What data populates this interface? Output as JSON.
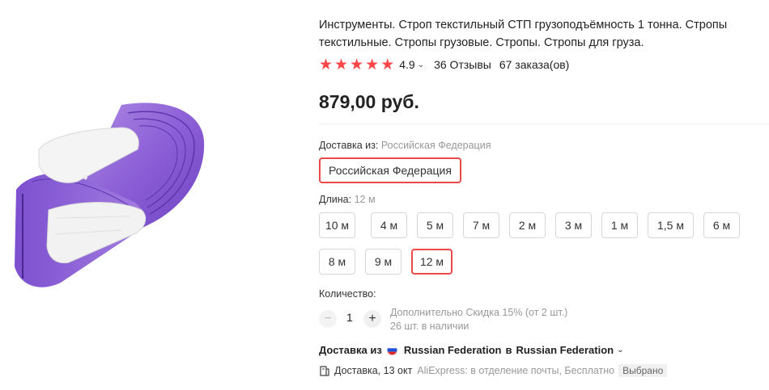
{
  "product": {
    "title": "Инструменты. Строп текстильный СТП грузоподъёмность 1 тонна. Стропы текстильные. Стропы грузовые. Стропы. Стропы для груза.",
    "rating": "4.9",
    "stars_filled": 5,
    "reviews": "36 Отзывы",
    "orders": "67 заказа(ов)",
    "price": "879,00 руб.",
    "accent_color": "#ff4747"
  },
  "shipping_from": {
    "label": "Доставка из:",
    "value": "Российская Федерация",
    "options": [
      "Российская Федерация"
    ],
    "selected": "Российская Федерация"
  },
  "length": {
    "label": "Длина:",
    "value": "12 м",
    "options": [
      "10 м",
      "4 м",
      "5 м",
      "7 м",
      "2 м",
      "3 м",
      "1 м",
      "1,5 м",
      "6 м",
      "8 м",
      "9 м",
      "12 м"
    ],
    "selected": "12 м"
  },
  "quantity": {
    "label": "Количество:",
    "value": "1",
    "minus": "−",
    "plus": "+",
    "discount_note": "Дополнительно Скидка 15% (от 2 шт.)",
    "stock_note": "26 шт. в наличии"
  },
  "delivery": {
    "prefix": "Доставка из",
    "from": "Russian Federation",
    "in_word": "в",
    "to": "Russian Federation",
    "flag_icon": "russia-flag-icon"
  },
  "shipping": {
    "icon": "package-icon",
    "text": "Доставка, 13 окт",
    "service": "AliExpress: в отделение почты, Бесплатно",
    "badge": "Выбрано"
  }
}
